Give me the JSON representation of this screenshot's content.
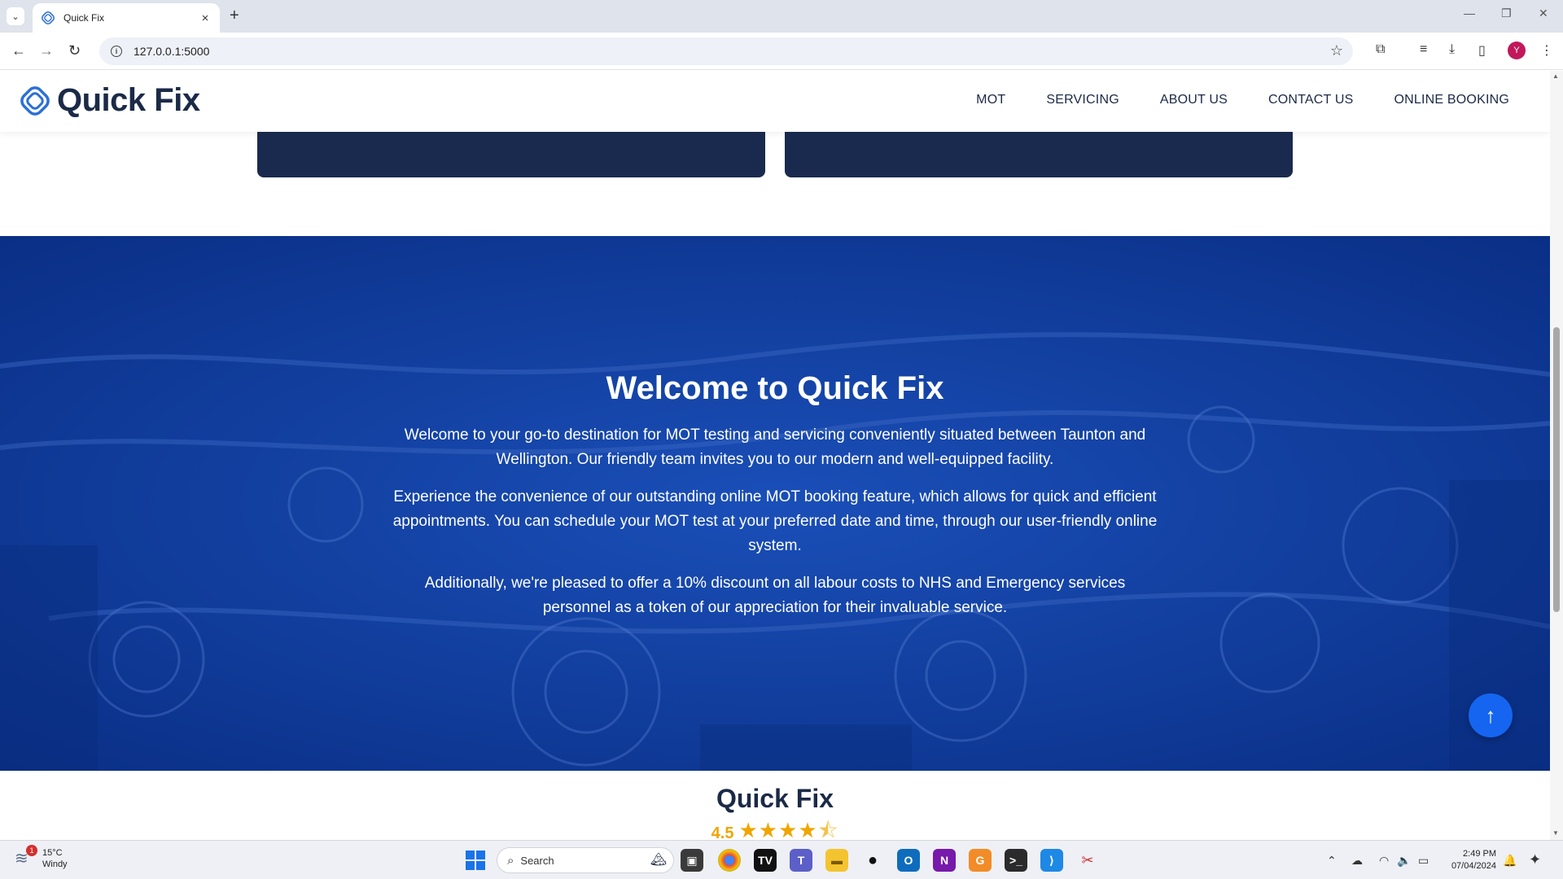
{
  "browser": {
    "tab_title": "Quick Fix",
    "url": "127.0.0.1:5000",
    "profile_initial": "Y"
  },
  "site": {
    "brand_name": "Quick Fix",
    "nav": [
      "MOT",
      "SERVICING",
      "ABOUT US",
      "CONTACT US",
      "ONLINE BOOKING"
    ]
  },
  "hero": {
    "title": "Welcome to Quick Fix",
    "paragraphs": [
      "Welcome to your go-to destination for MOT testing and servicing conveniently situated between Taunton and Wellington. Our friendly team invites you to our modern and well-equipped facility.",
      "Experience the convenience of our outstanding online MOT booking feature, which allows for quick and efficient appointments. You can schedule your MOT test at your preferred date and time, through our user-friendly online system.",
      "Additionally, we're pleased to offer a 10% discount on all labour costs to NHS and Emergency services personnel as a token of our appreciation for their invaluable service."
    ]
  },
  "rating": {
    "title": "Quick Fix",
    "value": "4.5",
    "stars": 4.5
  },
  "taskbar": {
    "weather_temp": "15°C",
    "weather_desc": "Windy",
    "weather_badge": "1",
    "search_placeholder": "Search",
    "time": "2:49 PM",
    "date": "07/04/2024"
  },
  "colors": {
    "brand_dark": "#1b2a47",
    "hero_blue": "#0f3c9e",
    "card_navy": "#1a2a4f",
    "accent_blue": "#1565f0",
    "star_gold": "#f0a500"
  }
}
